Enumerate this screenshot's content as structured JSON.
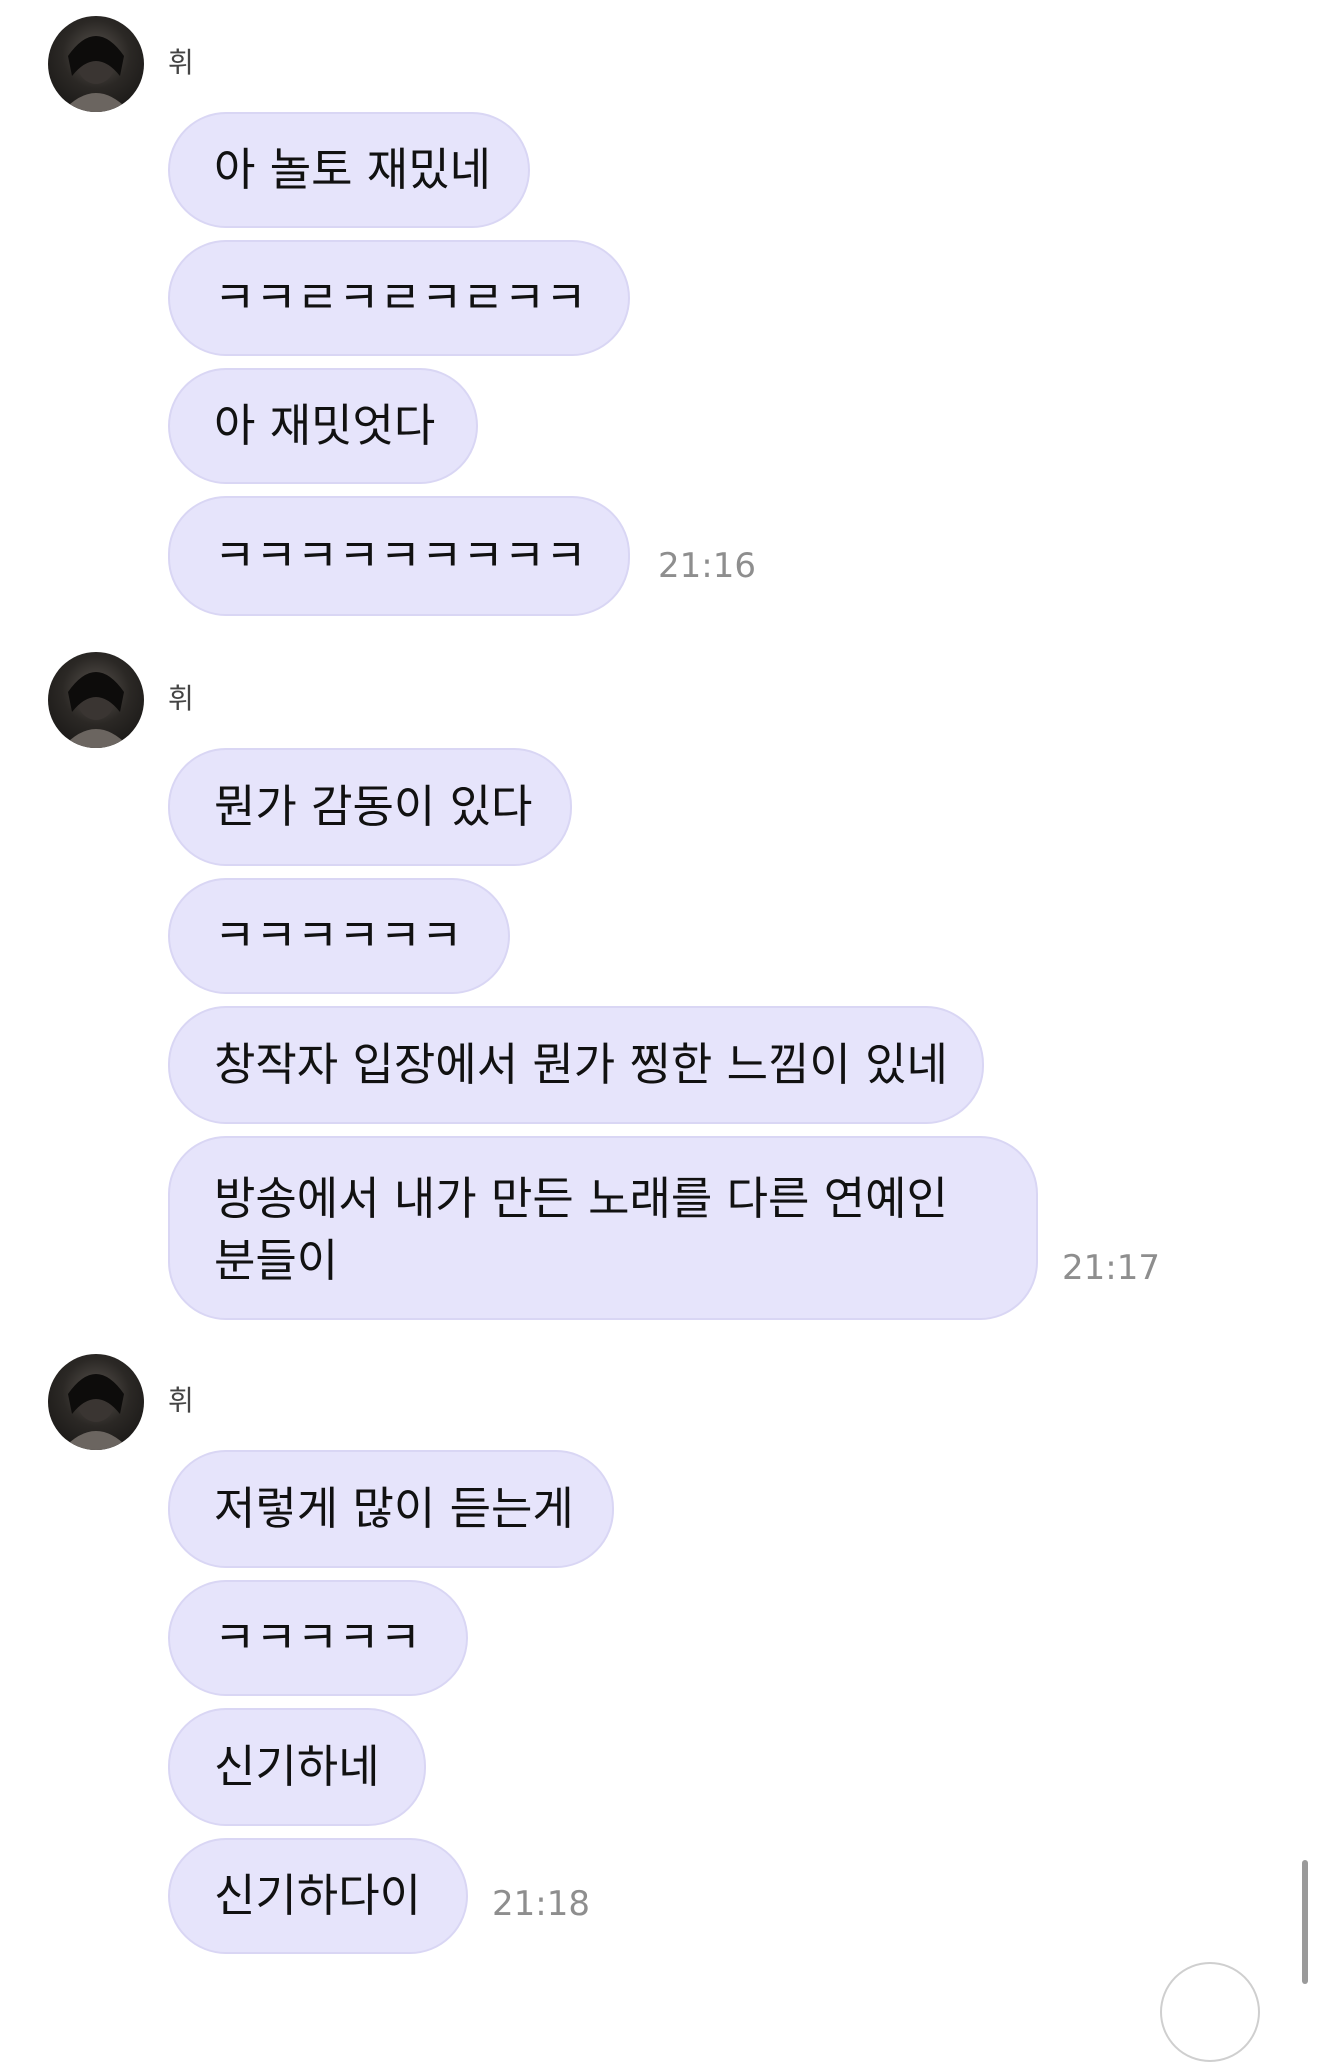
{
  "colors": {
    "bubble_bg": "#e6e4fb",
    "bubble_border": "#d9d6f4",
    "timestamp": "#8e8e8e"
  },
  "groups": [
    {
      "sender": "휘",
      "avatar_icon": "profile-photo",
      "messages": [
        "아 놀토 재밌네",
        "ㅋㅋㄹㅋㄹㅋㄹㅋㅋ",
        "아 재밋엇다",
        "ㅋㅋㅋㅋㅋㅋㅋㅋㅋ"
      ],
      "time": "21:16"
    },
    {
      "sender": "휘",
      "avatar_icon": "profile-photo",
      "messages": [
        "뭔가 감동이 있다",
        "ㅋㅋㅋㅋㅋㅋ",
        "창작자 입장에서 뭔가 찡한 느낌이 있네",
        "방송에서 내가 만든 노래를 다른 연예인 분들이"
      ],
      "time": "21:17"
    },
    {
      "sender": "휘",
      "avatar_icon": "profile-photo",
      "messages": [
        "저렇게 많이 듣는게",
        "ㅋㅋㅋㅋㅋ",
        "신기하네",
        "신기하다이"
      ],
      "time": "21:18"
    }
  ]
}
